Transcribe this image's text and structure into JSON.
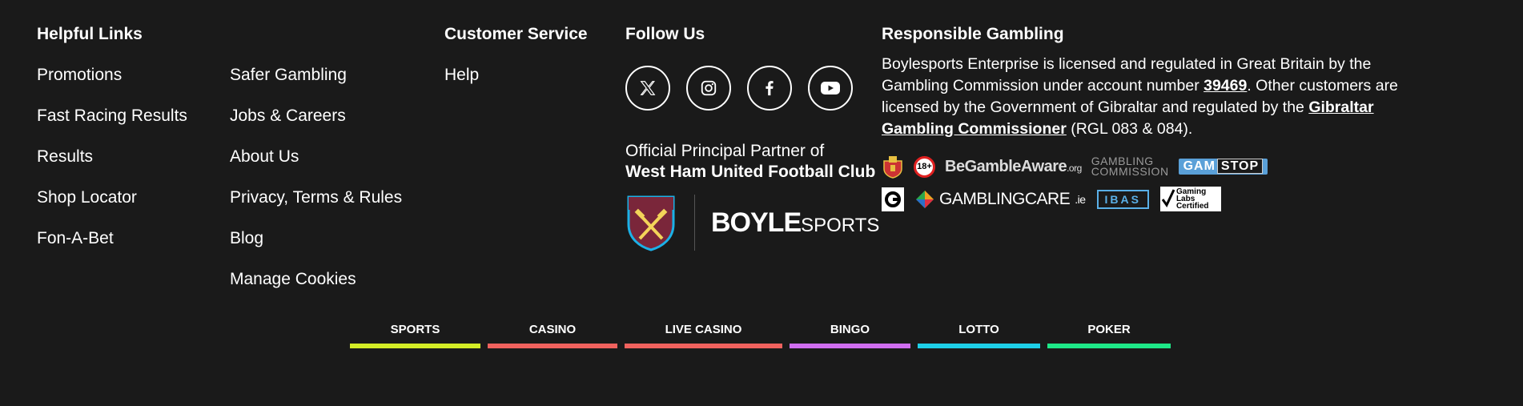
{
  "helpful_links": {
    "heading": "Helpful Links",
    "column1": [
      "Promotions",
      "Fast Racing Results",
      "Results",
      "Shop Locator",
      "Fon-A-Bet"
    ],
    "column2": [
      "Safer Gambling",
      "Jobs & Careers",
      "About Us",
      "Privacy, Terms & Rules",
      "Blog",
      "Manage Cookies"
    ]
  },
  "customer_service": {
    "heading": "Customer Service",
    "items": [
      "Help"
    ]
  },
  "follow_us": {
    "heading": "Follow Us",
    "socials": [
      "x-icon",
      "instagram-icon",
      "facebook-icon",
      "youtube-icon"
    ],
    "partner_line1": "Official Principal Partner of",
    "partner_line2": "West Ham United Football Club",
    "brand_main": "BOYLE",
    "brand_sub": "SPORTS"
  },
  "responsible_gambling": {
    "heading": "Responsible Gambling",
    "text_part1": "Boylesports Enterprise is licensed and regulated in Great Britain by the Gambling Commission under account number ",
    "account_number": "39469",
    "text_part2": ". Other customers are licensed by the Government of Gibraltar and regulated by the ",
    "gibraltar_link": "Gibraltar Gambling Commissioner",
    "text_part3": " (RGL 083 & 084).",
    "badges": {
      "age": "18+",
      "begambleaware": "BeGambleAware",
      "begambleaware_suffix": ".org",
      "gambling_commission_1": "GAMBLING",
      "gambling_commission_2": "COMMISSION",
      "gamstop_1": "GAM",
      "gamstop_2": "STOP",
      "gamblingcare": "GAMBLINGCARE",
      "gamblingcare_suffix": ".ie",
      "ibas": "IBAS",
      "glc_1": "Gaming",
      "glc_2": "Labs",
      "glc_3": "Certified"
    }
  },
  "products": [
    {
      "label": "SPORTS",
      "color": "#d4ed26",
      "width": 163
    },
    {
      "label": "CASINO",
      "color": "#f0625e",
      "width": 162
    },
    {
      "label": "LIVE CASINO",
      "color": "#f0625e",
      "width": 197
    },
    {
      "label": "BINGO",
      "color": "#d06ef0",
      "width": 151
    },
    {
      "label": "LOTTO",
      "color": "#1ecfe8",
      "width": 153
    },
    {
      "label": "POKER",
      "color": "#1ee888",
      "width": 154
    }
  ]
}
